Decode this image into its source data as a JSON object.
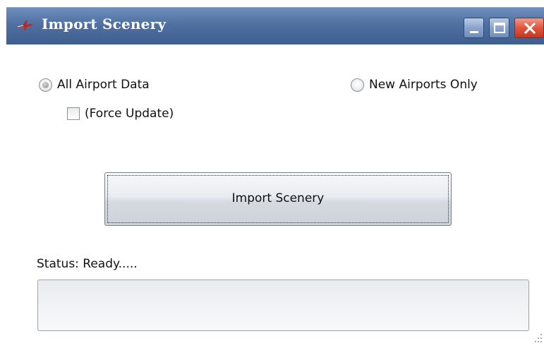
{
  "window": {
    "title": "Import Scenery",
    "icon": "airplane-icon"
  },
  "titlebar_buttons": {
    "minimize_icon": "minimize-icon",
    "maximize_icon": "maximize-icon",
    "close_icon": "close-icon"
  },
  "options": {
    "all_airport_data": {
      "label": "All Airport Data",
      "checked": true
    },
    "new_airports_only": {
      "label": "New Airports Only",
      "checked": false
    },
    "force_update": {
      "label": "(Force Update)",
      "checked": false
    }
  },
  "import_button": {
    "label": "Import Scenery"
  },
  "status": {
    "label": "Status: Ready.....",
    "box_text": ""
  },
  "colors": {
    "titlebar": "#4f70a0",
    "close_button": "#e0553f",
    "title_text": "#ffffff"
  }
}
